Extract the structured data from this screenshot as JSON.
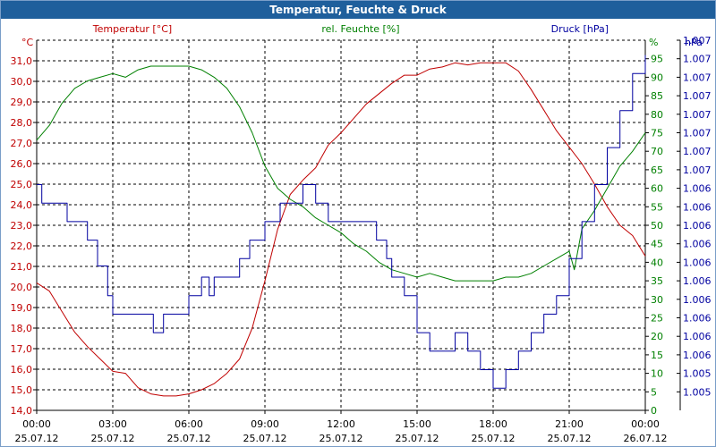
{
  "title": "Temperatur, Feuchte & Druck",
  "colors": {
    "temperature": "#c00000",
    "humidity": "#008000",
    "pressure": "#0000a0",
    "titlebar": "#1f5f9c"
  },
  "chart_data": {
    "type": "line",
    "title": "Temperatur, Feuchte & Druck",
    "x_ticks": [
      {
        "time": "00:00",
        "date": "25.07.12"
      },
      {
        "time": "03:00",
        "date": "25.07.12"
      },
      {
        "time": "06:00",
        "date": "25.07.12"
      },
      {
        "time": "09:00",
        "date": "25.07.12"
      },
      {
        "time": "12:00",
        "date": "25.07.12"
      },
      {
        "time": "15:00",
        "date": "25.07.12"
      },
      {
        "time": "18:00",
        "date": "25.07.12"
      },
      {
        "time": "21:00",
        "date": "25.07.12"
      },
      {
        "time": "00:00",
        "date": "26.07.12"
      }
    ],
    "x_range_hours": [
      0,
      24
    ],
    "axes": {
      "temperature": {
        "label": "Temperatur [°C]",
        "unit": "°C",
        "range": [
          14.0,
          32.0
        ],
        "ticks": [
          "14,0",
          "15,0",
          "16,0",
          "17,0",
          "18,0",
          "19,0",
          "20,0",
          "21,0",
          "22,0",
          "23,0",
          "24,0",
          "25,0",
          "26,0",
          "27,0",
          "28,0",
          "29,0",
          "30,0",
          "31,0"
        ]
      },
      "humidity": {
        "label": "rel. Feuchte [%]",
        "unit": "%",
        "range": [
          0,
          100
        ],
        "ticks": [
          "0",
          "5",
          "10",
          "15",
          "20",
          "25",
          "30",
          "35",
          "40",
          "45",
          "50",
          "55",
          "60",
          "65",
          "70",
          "75",
          "80",
          "85",
          "90",
          "95"
        ]
      },
      "pressure": {
        "label": "Druck [hPa]",
        "unit": "hPa",
        "ticks": [
          "1.005",
          "1.005",
          "1.006",
          "1.006",
          "1.006",
          "1.006",
          "1.006",
          "1.006",
          "1.006",
          "1.006",
          "1.006",
          "1.006",
          "1.007",
          "1.007",
          "1.007",
          "1.007",
          "1.007",
          "1.007",
          "1.007",
          "1.007"
        ]
      }
    },
    "grid": true,
    "series": [
      {
        "name": "Temperatur [°C]",
        "axis": "temperature",
        "color": "#c00000",
        "points": [
          [
            0,
            20.2
          ],
          [
            0.5,
            19.8
          ],
          [
            1,
            18.8
          ],
          [
            1.5,
            17.8
          ],
          [
            2,
            17.1
          ],
          [
            2.5,
            16.5
          ],
          [
            3,
            15.9
          ],
          [
            3.5,
            15.8
          ],
          [
            4,
            15.1
          ],
          [
            4.5,
            14.8
          ],
          [
            5,
            14.7
          ],
          [
            5.5,
            14.7
          ],
          [
            6,
            14.8
          ],
          [
            6.5,
            15.0
          ],
          [
            7,
            15.3
          ],
          [
            7.5,
            15.8
          ],
          [
            8,
            16.5
          ],
          [
            8.5,
            18.0
          ],
          [
            9,
            20.3
          ],
          [
            9.5,
            22.8
          ],
          [
            10,
            24.5
          ],
          [
            10.5,
            25.2
          ],
          [
            11,
            25.8
          ],
          [
            11.5,
            26.9
          ],
          [
            12,
            27.5
          ],
          [
            12.5,
            28.2
          ],
          [
            13,
            28.9
          ],
          [
            13.5,
            29.4
          ],
          [
            14,
            29.9
          ],
          [
            14.5,
            30.3
          ],
          [
            15,
            30.3
          ],
          [
            15.5,
            30.6
          ],
          [
            16,
            30.7
          ],
          [
            16.5,
            30.9
          ],
          [
            17,
            30.8
          ],
          [
            17.5,
            30.9
          ],
          [
            18,
            30.9
          ],
          [
            18.5,
            30.9
          ],
          [
            19,
            30.5
          ],
          [
            19.5,
            29.6
          ],
          [
            20,
            28.6
          ],
          [
            20.5,
            27.6
          ],
          [
            21,
            26.8
          ],
          [
            21.5,
            26.0
          ],
          [
            22,
            25.0
          ],
          [
            22.5,
            23.9
          ],
          [
            23,
            23.0
          ],
          [
            23.5,
            22.5
          ],
          [
            24,
            21.5
          ]
        ]
      },
      {
        "name": "rel. Feuchte [%]",
        "axis": "humidity",
        "color": "#008000",
        "points": [
          [
            0,
            73
          ],
          [
            0.5,
            77
          ],
          [
            1,
            83
          ],
          [
            1.5,
            87
          ],
          [
            2,
            89
          ],
          [
            2.5,
            90
          ],
          [
            3,
            91
          ],
          [
            3.5,
            90
          ],
          [
            4,
            92
          ],
          [
            4.5,
            93
          ],
          [
            5,
            93
          ],
          [
            5.5,
            93
          ],
          [
            6,
            93
          ],
          [
            6.5,
            92
          ],
          [
            7,
            90
          ],
          [
            7.5,
            87
          ],
          [
            8,
            82
          ],
          [
            8.5,
            75
          ],
          [
            9,
            66
          ],
          [
            9.5,
            60
          ],
          [
            10,
            57
          ],
          [
            10.5,
            55
          ],
          [
            11,
            52
          ],
          [
            11.5,
            50
          ],
          [
            12,
            48
          ],
          [
            12.5,
            45
          ],
          [
            13,
            43
          ],
          [
            13.5,
            40
          ],
          [
            14,
            38
          ],
          [
            14.5,
            37
          ],
          [
            15,
            36
          ],
          [
            15.5,
            37
          ],
          [
            16,
            36
          ],
          [
            16.5,
            35
          ],
          [
            17,
            35
          ],
          [
            17.5,
            35
          ],
          [
            18,
            35
          ],
          [
            18.5,
            36
          ],
          [
            19,
            36
          ],
          [
            19.5,
            37
          ],
          [
            20,
            39
          ],
          [
            20.5,
            41
          ],
          [
            21,
            43
          ],
          [
            21.2,
            38
          ],
          [
            21.5,
            49
          ],
          [
            22,
            54
          ],
          [
            22.5,
            60
          ],
          [
            23,
            66
          ],
          [
            23.5,
            70
          ],
          [
            24,
            75
          ]
        ]
      },
      {
        "name": "Druck [hPa]",
        "axis": "pressure",
        "color": "#0000a0",
        "step": true,
        "points": [
          [
            0,
            61
          ],
          [
            0.2,
            56
          ],
          [
            1.2,
            51
          ],
          [
            2,
            46
          ],
          [
            2.4,
            39
          ],
          [
            2.8,
            31
          ],
          [
            3,
            26
          ],
          [
            4.6,
            21
          ],
          [
            5,
            26
          ],
          [
            6,
            31
          ],
          [
            6.5,
            36
          ],
          [
            6.8,
            31
          ],
          [
            7,
            36
          ],
          [
            8,
            41
          ],
          [
            8.4,
            46
          ],
          [
            9,
            51
          ],
          [
            9.6,
            56
          ],
          [
            10.5,
            61
          ],
          [
            11,
            56
          ],
          [
            11.5,
            51
          ],
          [
            12,
            51
          ],
          [
            13,
            51
          ],
          [
            13.4,
            46
          ],
          [
            13.8,
            41
          ],
          [
            14,
            36
          ],
          [
            14.5,
            31
          ],
          [
            15,
            21
          ],
          [
            15.5,
            16
          ],
          [
            16,
            16
          ],
          [
            16.5,
            21
          ],
          [
            17,
            16
          ],
          [
            17.5,
            11
          ],
          [
            18,
            6
          ],
          [
            18.5,
            11
          ],
          [
            19,
            16
          ],
          [
            19.5,
            21
          ],
          [
            20,
            26
          ],
          [
            20.5,
            31
          ],
          [
            21,
            41
          ],
          [
            21.5,
            51
          ],
          [
            22,
            61
          ],
          [
            22.5,
            71
          ],
          [
            23,
            81
          ],
          [
            23.5,
            91
          ],
          [
            24,
            96
          ]
        ]
      }
    ]
  }
}
